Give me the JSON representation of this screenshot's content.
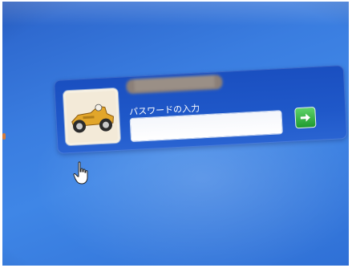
{
  "login": {
    "user_name": "██████████",
    "password_label": "パスワードの入力",
    "password_value": "",
    "avatar_icon": "race-car-icon",
    "submit_icon": "arrow-right-icon"
  },
  "colors": {
    "background": "#3a7de0",
    "tile": "#1f58c9",
    "submit": "#2fb53e"
  }
}
